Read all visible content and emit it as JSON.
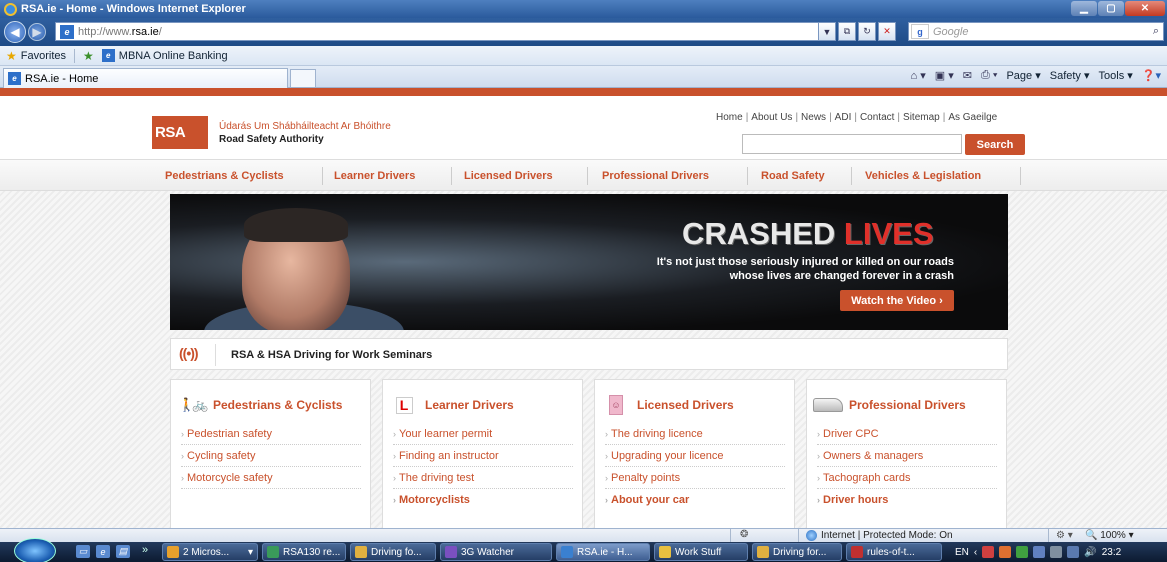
{
  "window": {
    "title": "RSA.ie - Home - Windows Internet Explorer"
  },
  "addressbar": {
    "url_prefix": "http://www.",
    "url_domain": "rsa.ie",
    "url_suffix": "/",
    "search_placeholder": "Google",
    "search_engine_icon": "google-icon"
  },
  "favorites_bar": {
    "favorites_label": "Favorites",
    "links": [
      "MBNA Online Banking"
    ]
  },
  "tabs": [
    {
      "label": "RSA.ie - Home"
    }
  ],
  "command_bar": {
    "page": "Page",
    "safety": "Safety",
    "tools": "Tools"
  },
  "site": {
    "logo_text": "RSA",
    "name_irish": "Údarás Um Shábháilteacht Ar Bhóithre",
    "name_english": "Road Safety Authority",
    "accent_color": "#c9512c",
    "top_links": [
      "Home",
      "About Us",
      "News",
      "ADI",
      "Contact",
      "Sitemap",
      "As Gaeilge"
    ],
    "search_button": "Search",
    "nav": [
      "Pedestrians & Cyclists",
      "Learner Drivers",
      "Licensed Drivers",
      "Professional Drivers",
      "Road Safety",
      "Vehicles & Legislation"
    ],
    "banner": {
      "headline_part1": "CRASHED",
      "headline_part2": "LIVES",
      "tagline_line1": "It's not just those seriously injured or killed on our roads",
      "tagline_line2": "whose lives are changed forever in a crash",
      "button": "Watch the Video ›"
    },
    "seminar": {
      "icon": "broadcast-icon",
      "title": "RSA & HSA Driving for Work Seminars"
    },
    "cards": [
      {
        "title": "Pedestrians & Cyclists",
        "icon": "pedestrian-cyclist-icon",
        "links": [
          "Pedestrian safety",
          "Cycling safety",
          "Motorcycle safety"
        ],
        "bold_link": ""
      },
      {
        "title": "Learner Drivers",
        "icon": "l-plate-icon",
        "links": [
          "Your learner permit",
          "Finding an instructor",
          "The driving test"
        ],
        "bold_link": "Motorcyclists"
      },
      {
        "title": "Licensed Drivers",
        "icon": "licence-icon",
        "links": [
          "The driving licence",
          "Upgrading your licence",
          "Penalty points"
        ],
        "bold_link": "About your car"
      },
      {
        "title": "Professional Drivers",
        "icon": "van-icon",
        "links": [
          "Driver CPC",
          "Owners & managers",
          "Tachograph cards"
        ],
        "bold_link": "Driver hours"
      }
    ]
  },
  "statusbar": {
    "zone": "Internet | Protected Mode: On",
    "zoom": "100%"
  },
  "taskbar": {
    "buttons": [
      "2 Micros...",
      "RSA130 re...",
      "Driving fo...",
      "3G Watcher",
      "RSA.ie - H...",
      "Work Stuff",
      "Driving for...",
      "rules-of-t..."
    ],
    "language": "EN",
    "clock": "23:2"
  }
}
